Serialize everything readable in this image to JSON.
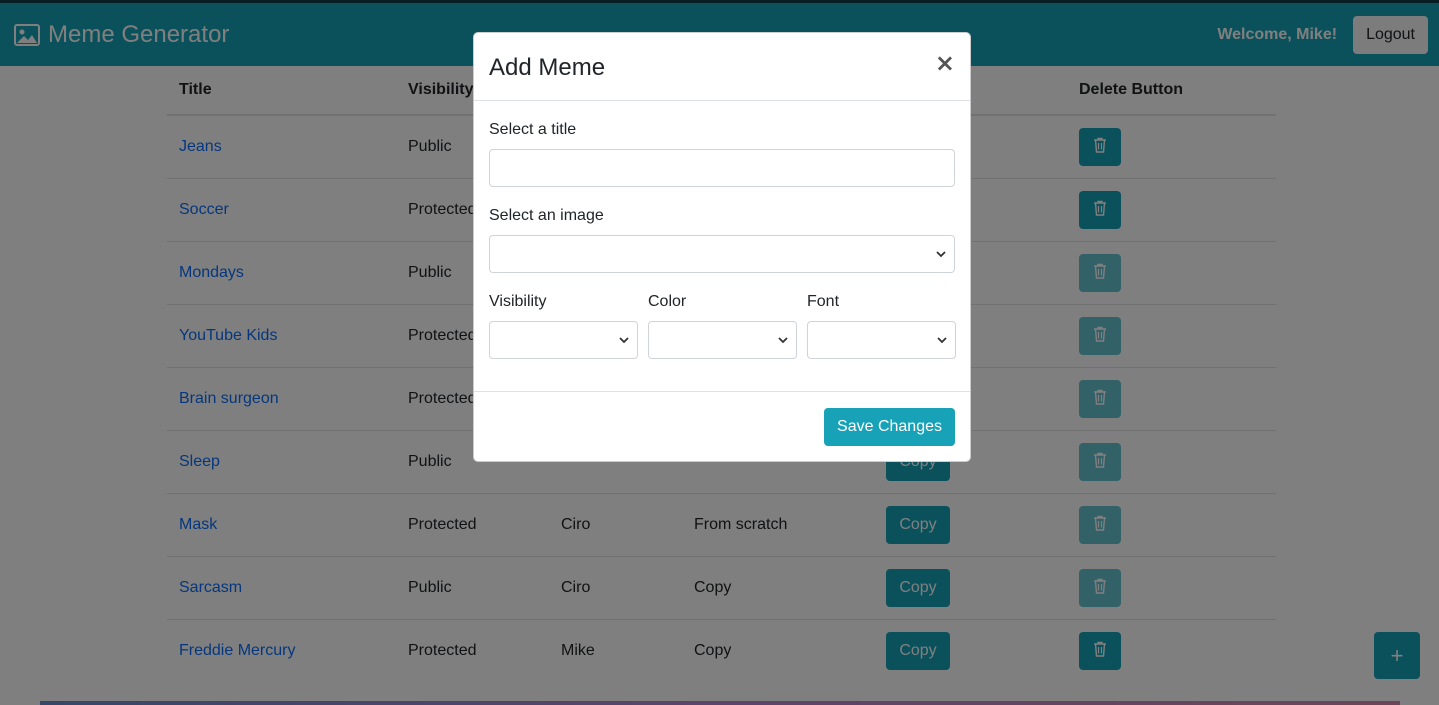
{
  "navbar": {
    "brand_icon": "image-icon",
    "brand": "Meme Generator",
    "welcome": "Welcome, Mike!",
    "logout_label": "Logout",
    "color": "#17a2b8"
  },
  "table": {
    "headers": [
      "Title",
      "Visibility",
      "",
      "",
      "",
      "Delete Button"
    ],
    "rows": [
      {
        "title": "Jeans",
        "visibility": "Public",
        "creator": "",
        "origin": "",
        "copy": "",
        "delete_enabled": true
      },
      {
        "title": "Soccer",
        "visibility": "Protected",
        "creator": "",
        "origin": "",
        "copy": "",
        "delete_enabled": true
      },
      {
        "title": "Mondays",
        "visibility": "Public",
        "creator": "",
        "origin": "",
        "copy": "",
        "delete_enabled": false
      },
      {
        "title": "YouTube Kids",
        "visibility": "Protected",
        "creator": "",
        "origin": "",
        "copy": "",
        "delete_enabled": false
      },
      {
        "title": "Brain surgeon",
        "visibility": "Protected",
        "creator": "",
        "origin": "",
        "copy": "",
        "delete_enabled": false
      },
      {
        "title": "Sleep",
        "visibility": "Public",
        "creator": "",
        "origin": "",
        "copy": "Copy",
        "delete_enabled": false
      },
      {
        "title": "Mask",
        "visibility": "Protected",
        "creator": "Ciro",
        "origin": "From scratch",
        "copy": "Copy",
        "delete_enabled": false
      },
      {
        "title": "Sarcasm",
        "visibility": "Public",
        "creator": "Ciro",
        "origin": "Copy",
        "copy": "Copy",
        "delete_enabled": false
      },
      {
        "title": "Freddie Mercury",
        "visibility": "Protected",
        "creator": "Mike",
        "origin": "Copy",
        "copy": "Copy",
        "delete_enabled": true
      }
    ],
    "delete_icon": "trash-icon"
  },
  "fab": {
    "label": "+",
    "icon": "plus-icon"
  },
  "modal": {
    "title": "Add Meme",
    "close_label": "×",
    "title_label": "Select a title",
    "title_value": "",
    "image_label": "Select an image",
    "image_value": "",
    "visibility_label": "Visibility",
    "visibility_value": "",
    "color_label": "Color",
    "color_value": "",
    "font_label": "Font",
    "font_value": "",
    "save_label": "Save Changes"
  }
}
